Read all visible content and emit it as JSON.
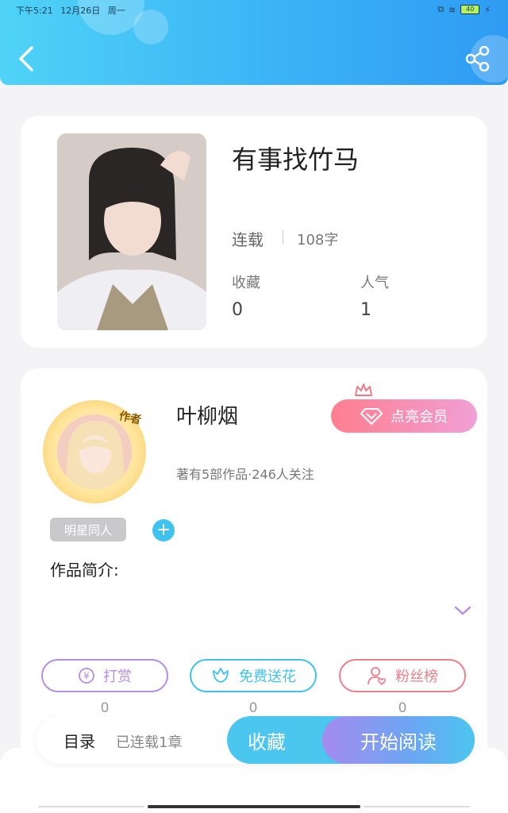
{
  "status_bar": {
    "time": "下午5:21",
    "date": "12月26日",
    "weekday": "周一",
    "battery": "40"
  },
  "book": {
    "title": "有事找竹马",
    "status": "连载",
    "word_count": "108字",
    "stats": [
      {
        "label": "收藏",
        "value": "0"
      },
      {
        "label": "人气",
        "value": "1"
      }
    ]
  },
  "author": {
    "badge": "作者",
    "name": "叶柳烟",
    "meta": "著有5部作品·246人关注",
    "vip_button": "点亮会员",
    "tag": "明星同人",
    "add_tag": "+",
    "intro_label": "作品简介:"
  },
  "actions": [
    {
      "label": "打赏",
      "count": "0",
      "color": "#b68ee8"
    },
    {
      "label": "免费送花",
      "count": "0",
      "color": "#3fc2f0"
    },
    {
      "label": "粉丝榜",
      "count": "0",
      "color": "#ef7f8a"
    }
  ],
  "bottom_bar": {
    "toc": "目录",
    "toc_meta": "已连载1章",
    "favorite": "收藏",
    "start_reading": "开始阅读"
  }
}
